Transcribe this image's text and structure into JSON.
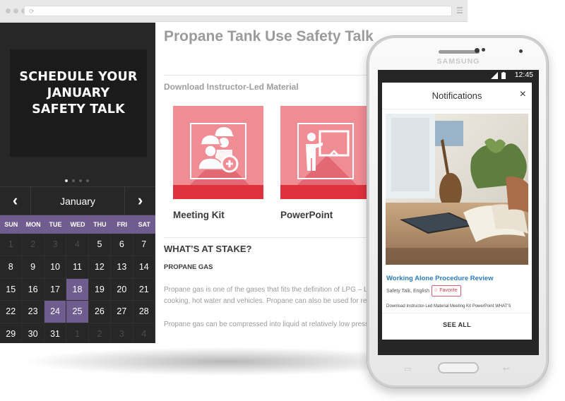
{
  "hero": {
    "text": "SCHEDULE YOUR\nJANUARY\nSAFETY TALK"
  },
  "calendar": {
    "month": "January",
    "weekdays": [
      "SUN",
      "MON",
      "TUE",
      "WED",
      "THU",
      "FRI",
      "SAT"
    ],
    "days": [
      {
        "d": "1",
        "muted": true
      },
      {
        "d": "2",
        "muted": true
      },
      {
        "d": "3",
        "muted": true
      },
      {
        "d": "4",
        "muted": true
      },
      {
        "d": "5"
      },
      {
        "d": "6"
      },
      {
        "d": "7"
      },
      {
        "d": "8"
      },
      {
        "d": "9"
      },
      {
        "d": "10"
      },
      {
        "d": "11"
      },
      {
        "d": "12"
      },
      {
        "d": "13"
      },
      {
        "d": "14"
      },
      {
        "d": "15"
      },
      {
        "d": "16"
      },
      {
        "d": "17"
      },
      {
        "d": "18",
        "hl": true
      },
      {
        "d": "19"
      },
      {
        "d": "20"
      },
      {
        "d": "21"
      },
      {
        "d": "22"
      },
      {
        "d": "23"
      },
      {
        "d": "24",
        "hl": true
      },
      {
        "d": "25",
        "hl": true
      },
      {
        "d": "26"
      },
      {
        "d": "27"
      },
      {
        "d": "28"
      },
      {
        "d": "29"
      },
      {
        "d": "30"
      },
      {
        "d": "31"
      },
      {
        "d": "1",
        "muted": true
      },
      {
        "d": "2",
        "muted": true
      },
      {
        "d": "3",
        "muted": true
      },
      {
        "d": "4",
        "muted": true
      }
    ]
  },
  "page": {
    "title": "Propane Tank Use Safety Talk",
    "download_heading": "Download Instructor-Led Material",
    "cards": [
      {
        "label": "Meeting Kit",
        "icon": "meeting-kit-workers-icon"
      },
      {
        "label": "PowerPoint",
        "icon": "presentation-board-icon"
      }
    ],
    "section_heading": "WHAT’S AT STAKE?",
    "sub_heading": "PROPANE GAS",
    "para1_line1": "Propane gas is one of the gases that fits the definition of LPG – Liquefied",
    "para1_line2": "cooking, hot water and vehicles. Propane can also be used for refrigerants",
    "para2_line1": "Propane gas can be compressed into liquid at relatively low pressures. Pro"
  },
  "phone": {
    "brand": "SAMSUNG",
    "status_time": "12:45",
    "notifications": {
      "title": "Notifications",
      "close": "×",
      "item_title": "Working Alone Procedure Review",
      "item_meta": "Safety Talk, English",
      "favorite_label": "Favorite",
      "item_desc": "Download Instructor-Led Material Meeting Kit PowerPoint WHAT'S",
      "see_all": "SEE ALL"
    }
  },
  "colors": {
    "accent_purple": "#6f5d8f",
    "card_pink": "#f08c94",
    "card_red": "#e0313f",
    "link_blue": "#2d7bbe"
  }
}
